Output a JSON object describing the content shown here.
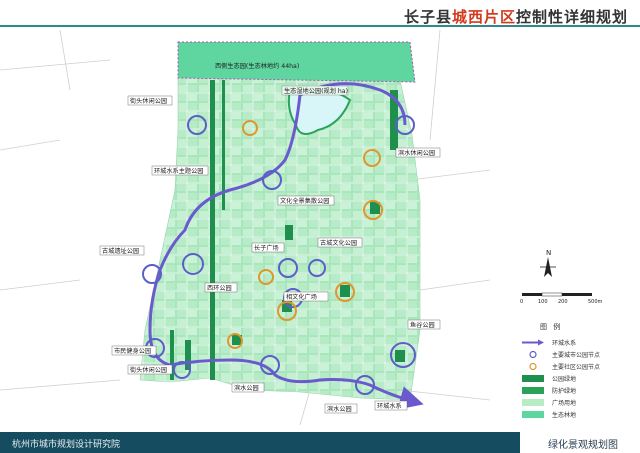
{
  "header": {
    "title_prefix": "长子县",
    "title_highlight": "城西片区",
    "title_suffix": "控制性详细规划"
  },
  "map": {
    "labels": [
      {
        "id": "top-forest",
        "text": "西侧生态园(生态林地约 44ha)"
      },
      {
        "id": "lake",
        "text": "生态湿地公园(规划 ha)"
      },
      {
        "id": "jietou-park",
        "text": "街头休闲公园"
      },
      {
        "id": "binshui-park-ne",
        "text": "滨水休闲公园"
      },
      {
        "id": "ring-water-theme",
        "text": "环城水系主题公园"
      },
      {
        "id": "culture-art",
        "text": "文化全景集散公园"
      },
      {
        "id": "ancient-heritage",
        "text": "古城遗址公园"
      },
      {
        "id": "changzi-square",
        "text": "长子广场"
      },
      {
        "id": "ancient-culture",
        "text": "古城文化公园"
      },
      {
        "id": "xihuan-park",
        "text": "西环公园"
      },
      {
        "id": "xiangwen-square",
        "text": "相文化广场"
      },
      {
        "id": "shimin-fitness",
        "text": "市民健身公园"
      },
      {
        "id": "jietou-park-sw",
        "text": "街头休闲公园"
      },
      {
        "id": "binshui-s",
        "text": "滨水公园"
      },
      {
        "id": "binshui-s2",
        "text": "滨水公园"
      },
      {
        "id": "ring-water",
        "text": "环城水系"
      },
      {
        "id": "yugu-park",
        "text": "鱼谷公园"
      }
    ]
  },
  "compass": {
    "north": "N"
  },
  "scale": {
    "ticks": [
      "0",
      "100",
      "200"
    ],
    "unit_label": "500m"
  },
  "legend": {
    "title": "图   例",
    "items": [
      {
        "label": "环城水系",
        "type": "arrow",
        "color": "#6a5acd"
      },
      {
        "label": "主要城市公园节点",
        "type": "circle-blue",
        "color": "#5b5fc7"
      },
      {
        "label": "主要社区公园节点",
        "type": "circle-orange",
        "color": "#e0962a"
      },
      {
        "label": "公园绿地",
        "type": "fill",
        "color": "#1f8f4e"
      },
      {
        "label": "防护绿地",
        "type": "fill",
        "color": "#2aa35a"
      },
      {
        "label": "广场用地",
        "type": "fill",
        "color": "#b8ecc4"
      },
      {
        "label": "生态林地",
        "type": "fill",
        "color": "#5fd6a0"
      }
    ]
  },
  "footer": {
    "left": "杭州市城市规划设计研究院",
    "right": "绿化景观规划图"
  }
}
